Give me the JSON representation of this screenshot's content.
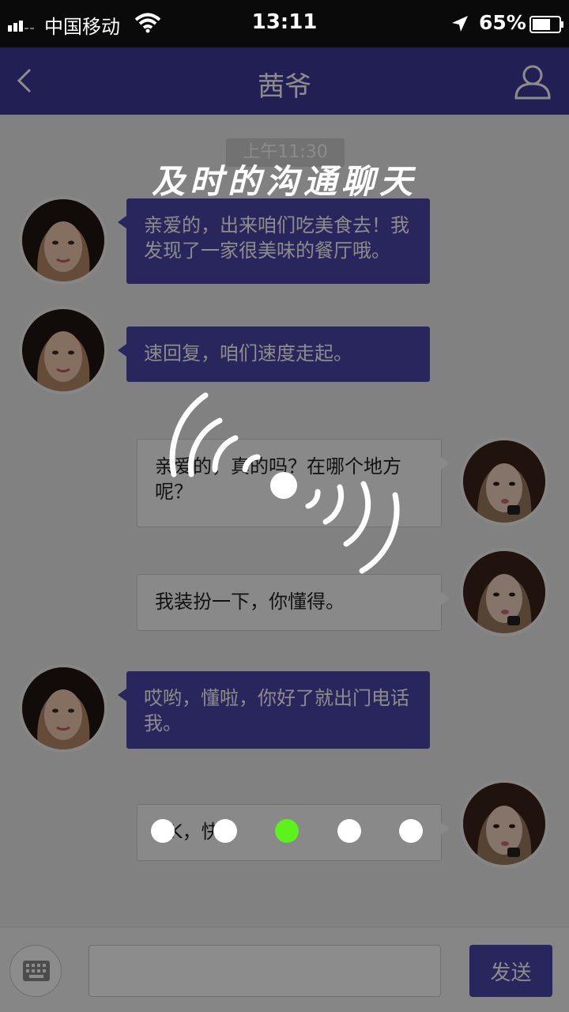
{
  "status_bar": {
    "carrier": "中国移动",
    "time": "13:11",
    "battery_percent": "65%"
  },
  "nav": {
    "title": "茜爷",
    "back_icon": "back-chevron-icon",
    "profile_icon": "user-profile-icon"
  },
  "chat": {
    "timestamp": "上午11:30",
    "messages": [
      {
        "side": "in",
        "text": "亲爱的，出来咱们吃美食去！我发现了一家很美味的餐厅哦。"
      },
      {
        "side": "in",
        "text": "速回复，咱们速度走起。"
      },
      {
        "side": "out",
        "text": "亲爱的，真的吗？在哪个地方呢？"
      },
      {
        "side": "out",
        "text": "我装扮一下，你懂得。"
      },
      {
        "side": "in",
        "text": "哎哟，懂啦，你好了就出门电话我。"
      },
      {
        "side": "out",
        "text": "OK，快。"
      }
    ]
  },
  "input_bar": {
    "send_label": "发送",
    "input_value": "",
    "keyboard_icon": "keyboard-icon"
  },
  "onboarding": {
    "headline": "及时的沟通聊天",
    "page_count": 5,
    "active_page": 3,
    "colors": {
      "dot_active": "#5df21c",
      "dot_inactive": "#ffffff"
    }
  },
  "colors": {
    "brand": "#3f3a9a",
    "incoming_bubble": "#4a45a8"
  }
}
